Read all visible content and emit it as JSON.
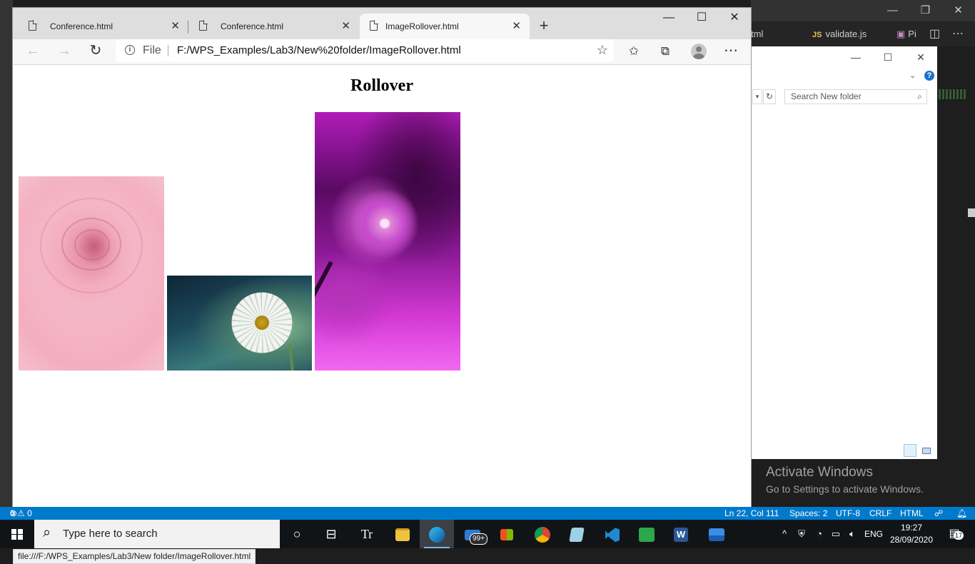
{
  "vscode": {
    "tabs": [
      {
        "label": "tml"
      },
      {
        "label": "validate.js",
        "prefix": "JS"
      },
      {
        "label": "Pi"
      }
    ],
    "status": {
      "errors": "0",
      "warnings": "0",
      "position": "Ln 22, Col 111",
      "spaces": "Spaces: 2",
      "encoding": "UTF-8",
      "eol": "CRLF",
      "language": "HTML"
    }
  },
  "explorer": {
    "search_placeholder": "Search New folder"
  },
  "watermark": {
    "title": "Activate Windows",
    "subtitle": "Go to Settings to activate Windows."
  },
  "browser": {
    "tabs": [
      {
        "label": "Conference.html",
        "active": false
      },
      {
        "label": "Conference.html",
        "active": false
      },
      {
        "label": "ImageRollover.html",
        "active": true
      }
    ],
    "address": {
      "scheme_label": "File",
      "url": "F:/WPS_Examples/Lab3/New%20folder/ImageRollover.html"
    },
    "page": {
      "heading": "Rollover",
      "images": [
        {
          "subject": "pink rose"
        },
        {
          "subject": "white daisy"
        },
        {
          "subject": "magenta blossom"
        }
      ]
    },
    "status_link": "file:///F:/WPS_Examples/Lab3/New folder/ImageRollover.html"
  },
  "taskbar": {
    "search_placeholder": "Type here to search",
    "mail_badge": "99+",
    "language": "ENG",
    "time": "19:27",
    "date": "28/09/2020",
    "notification_count": "17"
  }
}
